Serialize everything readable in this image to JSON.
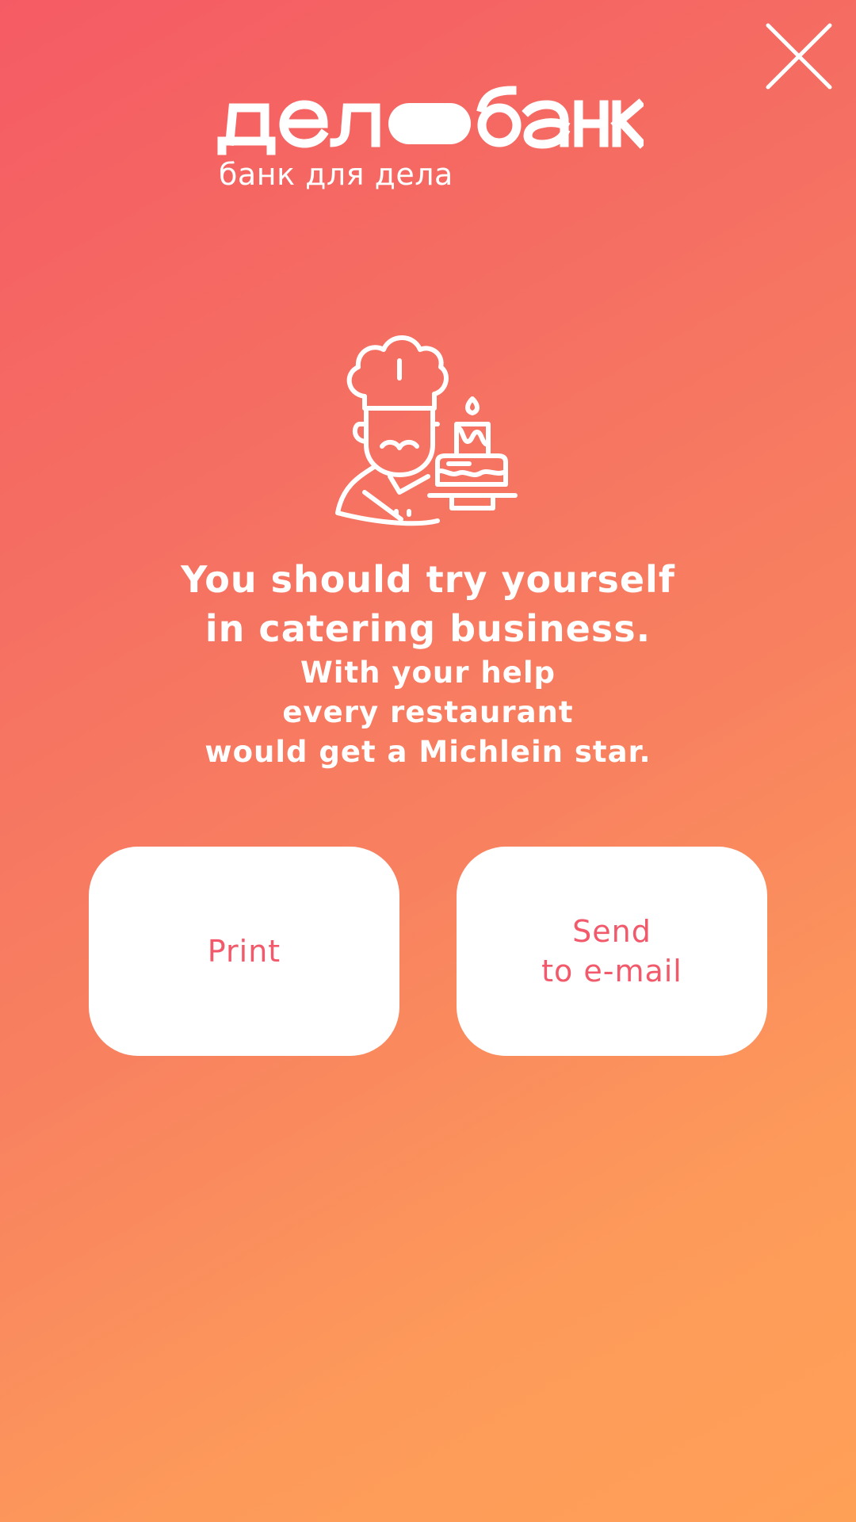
{
  "logo": {
    "brand_name": "делобанк",
    "tagline": "банк для дела"
  },
  "close": {
    "icon": "close-icon"
  },
  "illustration": {
    "icon": "chef-with-cake-icon"
  },
  "message": {
    "headline": [
      "You should try yourself",
      "in catering business."
    ],
    "subline": [
      "With your help",
      "every restaurant",
      "would get a Michlein star."
    ]
  },
  "actions": {
    "print_label": "Print",
    "email_label": [
      "Send",
      "to e-mail"
    ]
  },
  "colors": {
    "gradient_start": "#f55b64",
    "gradient_end": "#ffa057",
    "button_bg": "#ffffff",
    "button_text": "#f2596a"
  }
}
